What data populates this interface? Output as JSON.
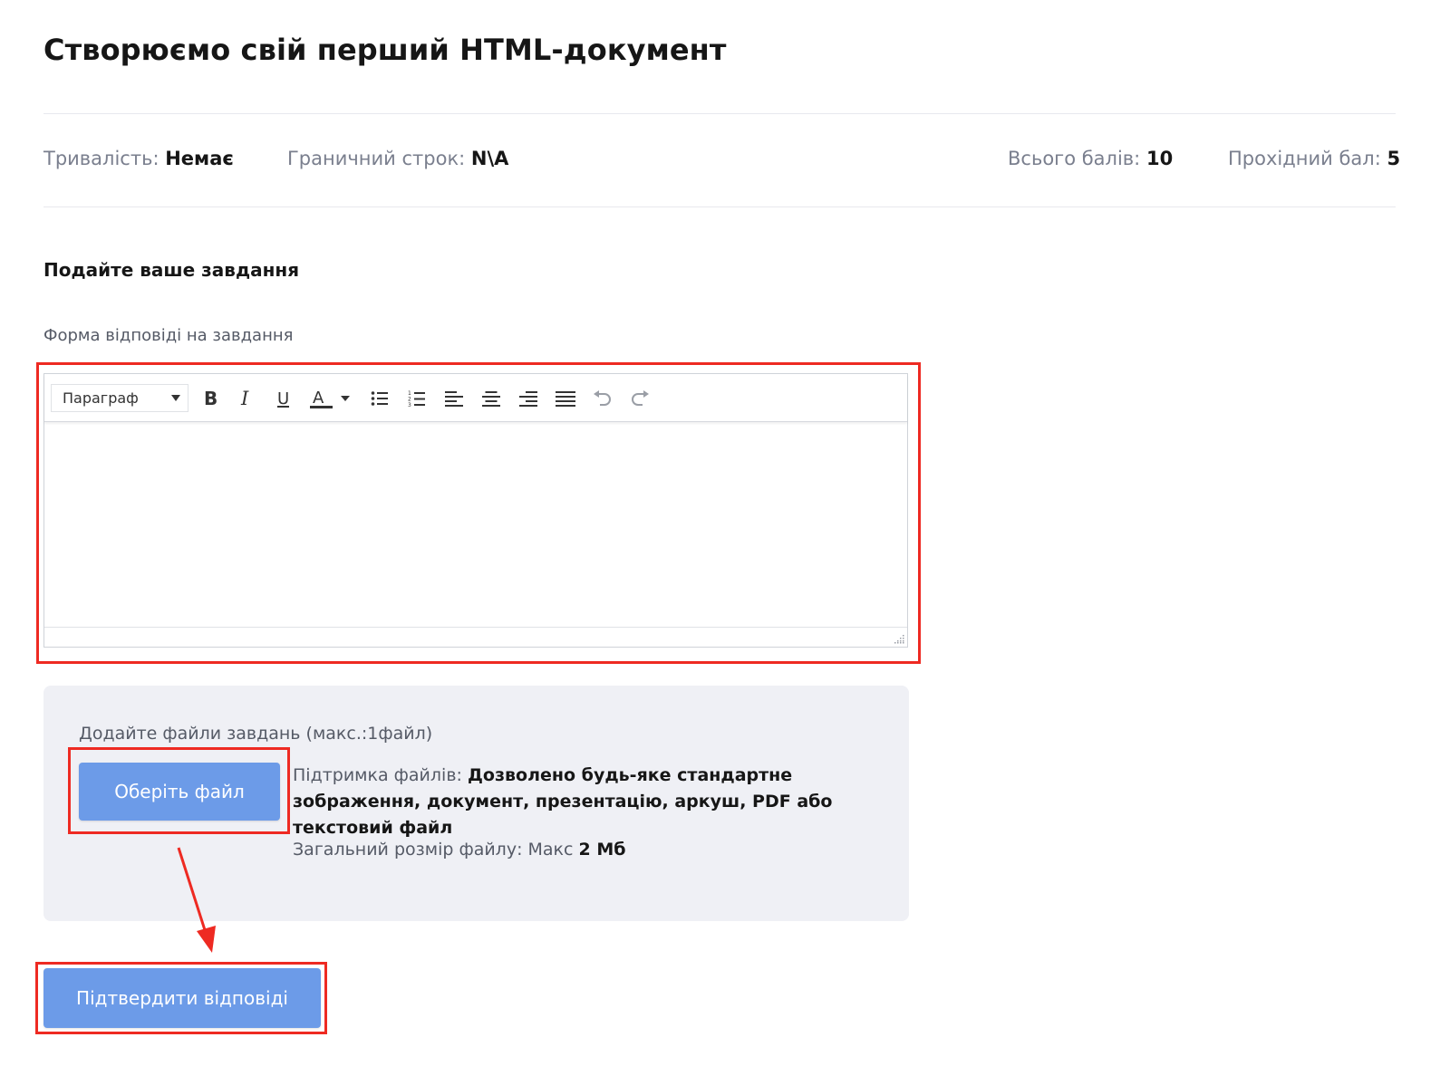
{
  "page": {
    "title": "Створюємо свій перший HTML-документ"
  },
  "meta": {
    "duration_label": "Тривалість:",
    "duration_value": "Немає",
    "deadline_label": "Граничний строк:",
    "deadline_value": "N\\A",
    "total_points_label": "Всього балів:",
    "total_points_value": "10",
    "passing_label": "Прохідний бал:",
    "passing_value": "5"
  },
  "submission": {
    "heading": "Подайте ваше завдання",
    "form_label": "Форма відповіді на завдання"
  },
  "editor": {
    "format_selected": "Параграф",
    "toolbar_icons": [
      "bold-icon",
      "italic-icon",
      "underline-icon",
      "text-color-icon",
      "bullet-list-icon",
      "numbered-list-icon",
      "align-left-icon",
      "align-center-icon",
      "align-right-icon",
      "justify-icon",
      "undo-icon",
      "redo-icon"
    ],
    "content": ""
  },
  "upload": {
    "label": "Додайте файли завдань (макс.:1файл)",
    "choose_button": "Оберіть файл",
    "support_label": "Підтримка файлів:",
    "support_value": "Дозволено будь-яке стандартне зображення, документ, презентацію, аркуш, PDF або текстовий файл",
    "size_label": "Загальний розмір файлу: Макс",
    "size_value": "2 Мб"
  },
  "actions": {
    "submit_button": "Підтвердити відповіді"
  },
  "colors": {
    "accent_button": "#6c9be8",
    "annotation_red": "#ee2a22",
    "panel_bg": "#eff0f5"
  }
}
